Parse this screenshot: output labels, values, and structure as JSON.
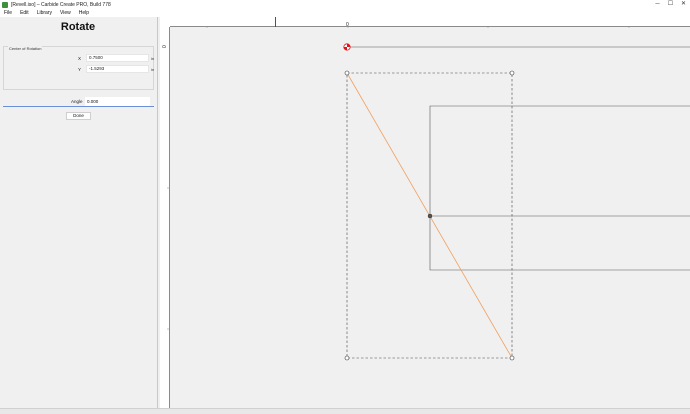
{
  "window": {
    "title": "[Revell.iso] – Carbide Create PRO, Build 778",
    "controls": {
      "minimize": "─",
      "maximize": "☐",
      "close": "✕"
    }
  },
  "menu": [
    "File",
    "Edit",
    "Library",
    "View",
    "Help"
  ],
  "panel": {
    "title": "Rotate",
    "center_of_rotation": {
      "label": "Center of Rotation",
      "x_label": "X",
      "x_value": "0.7500",
      "y_label": "Y",
      "y_value": "-1.5293",
      "unit": "in"
    },
    "angle_label": "Angle",
    "angle_value": "0.000",
    "done_label": "Done"
  },
  "ruler": {
    "top_zero": "0",
    "left_zero": "0"
  },
  "colors": {
    "rotation_line": "#f0a060",
    "cursor_marker": "#e0141e",
    "origin_marker": "#e0141e"
  }
}
